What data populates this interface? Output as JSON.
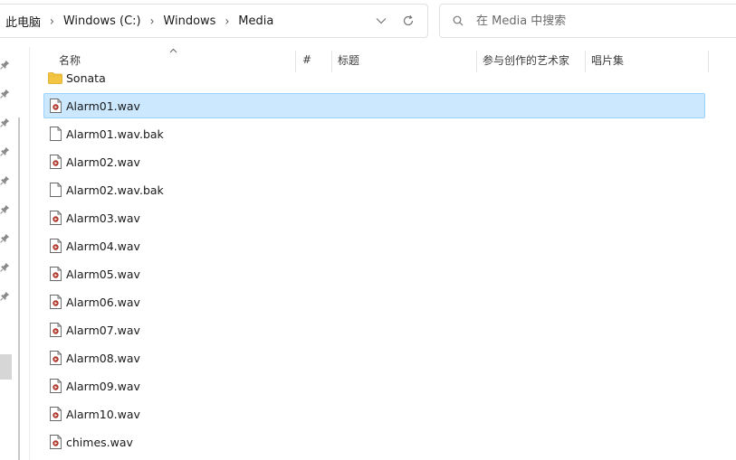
{
  "address_bar": {
    "breadcrumbs": [
      "此电脑",
      "Windows (C:)",
      "Windows",
      "Media"
    ]
  },
  "search": {
    "placeholder": "在 Media 中搜索"
  },
  "columns": {
    "name": "名称",
    "number": "#",
    "title": "标题",
    "contributing_artists": "参与创作的艺术家",
    "album": "唱片集"
  },
  "files": [
    {
      "name": "Sonata",
      "type": "folder"
    },
    {
      "name": "Alarm01.wav",
      "type": "audio",
      "selected": true
    },
    {
      "name": "Alarm01.wav.bak",
      "type": "file"
    },
    {
      "name": "Alarm02.wav",
      "type": "audio"
    },
    {
      "name": "Alarm02.wav.bak",
      "type": "file"
    },
    {
      "name": "Alarm03.wav",
      "type": "audio"
    },
    {
      "name": "Alarm04.wav",
      "type": "audio"
    },
    {
      "name": "Alarm05.wav",
      "type": "audio"
    },
    {
      "name": "Alarm06.wav",
      "type": "audio"
    },
    {
      "name": "Alarm07.wav",
      "type": "audio"
    },
    {
      "name": "Alarm08.wav",
      "type": "audio"
    },
    {
      "name": "Alarm09.wav",
      "type": "audio"
    },
    {
      "name": "Alarm10.wav",
      "type": "audio"
    },
    {
      "name": "chimes.wav",
      "type": "audio"
    }
  ],
  "icons": {
    "folder": "folder-icon",
    "audio": "audio-file-icon",
    "file": "blank-file-icon",
    "pin": "pin-icon",
    "chevron": "chevron-down-icon",
    "refresh": "refresh-icon",
    "search": "search-icon",
    "sort": "sort-ascending-icon"
  },
  "colors": {
    "selection_bg": "#cce8ff",
    "selection_border": "#99d1ff",
    "folder": "#f4c542",
    "audio_accent": "#c0392b"
  }
}
